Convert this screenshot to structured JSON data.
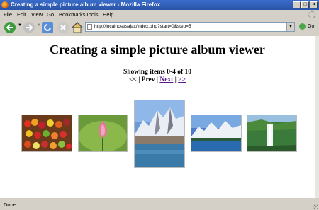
{
  "window": {
    "title": "Creating a simple picture album viewer - Mozilla Firefox"
  },
  "menu": {
    "items": [
      "File",
      "Edit",
      "View",
      "Go",
      "Bookmarks",
      "Tools",
      "Help"
    ]
  },
  "toolbar": {
    "address": "http://localhost/sajax/index.php?start=0&step=5",
    "go_label": "Go",
    "icons": [
      "back-icon",
      "forward-icon",
      "reload-icon",
      "stop-icon",
      "home-icon",
      "go-icon"
    ]
  },
  "page": {
    "heading": "Creating a simple picture album viewer",
    "showing": "Showing items 0-4 of 10",
    "pager": {
      "first": "<<",
      "prev": "Prev",
      "next": "Next",
      "last": ">>",
      "sep": "|"
    },
    "thumbnails": [
      {
        "subject": "fruit market stall"
      },
      {
        "subject": "lotus bud"
      },
      {
        "subject": "snowy mountain lake"
      },
      {
        "subject": "mountain lake panorama"
      },
      {
        "subject": "waterfall"
      }
    ]
  },
  "status": {
    "text": "Done"
  }
}
